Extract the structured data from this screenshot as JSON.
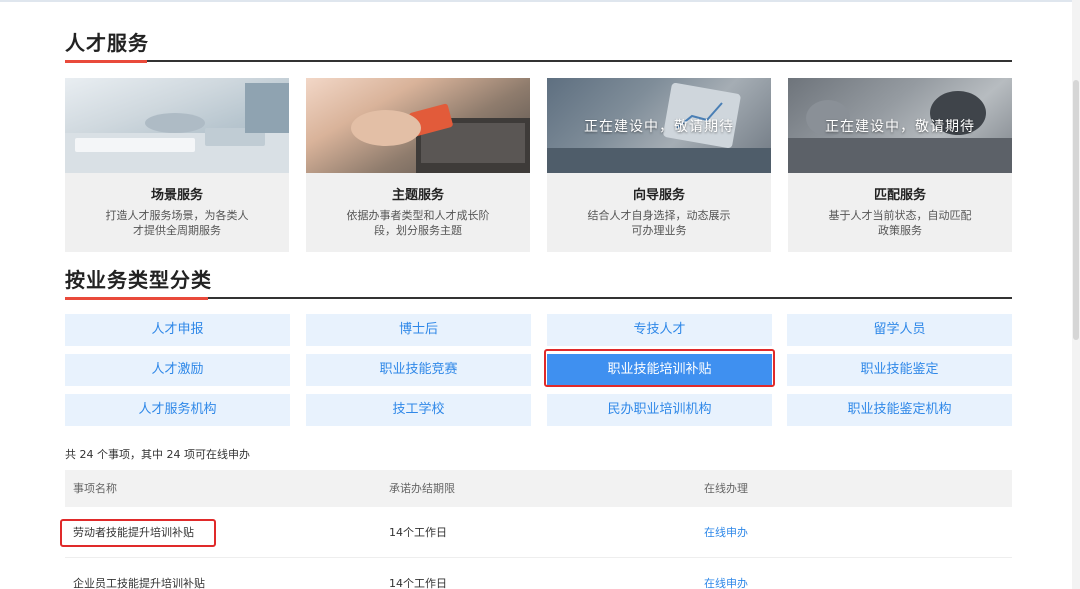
{
  "sections": {
    "talent_service_title": "人才服务",
    "by_type_title": "按业务类型分类"
  },
  "cards": [
    {
      "title": "场景服务",
      "desc_line1": "打造人才服务场景，为各类人",
      "desc_line2": "才提供全周期服务",
      "overlay": ""
    },
    {
      "title": "主题服务",
      "desc_line1": "依据办事者类型和人才成长阶",
      "desc_line2": "段，划分服务主题",
      "overlay": ""
    },
    {
      "title": "向导服务",
      "desc_line1": "结合人才自身选择，动态展示",
      "desc_line2": "可办理业务",
      "overlay": "正在建设中，敬请期待"
    },
    {
      "title": "匹配服务",
      "desc_line1": "基于人才当前状态，自动匹配",
      "desc_line2": "政策服务",
      "overlay": "正在建设中，敬请期待"
    }
  ],
  "categories": [
    [
      "人才申报",
      "博士后",
      "专技人才",
      "留学人员"
    ],
    [
      "人才激励",
      "职业技能竞赛",
      "职业技能培训补贴",
      "职业技能鉴定"
    ],
    [
      "人才服务机构",
      "技工学校",
      "民办职业培训机构",
      "职业技能鉴定机构"
    ]
  ],
  "active_category": "职业技能培训补贴",
  "summary": "共 24 个事项，其中 24 项可在线申办",
  "table": {
    "headers": [
      "事项名称",
      "承诺办结期限",
      "在线办理"
    ],
    "rows": [
      {
        "name": "劳动者技能提升培训补贴",
        "deadline": "14个工作日",
        "action": "在线申办"
      },
      {
        "name": "企业员工技能提升培训补贴",
        "deadline": "14个工作日",
        "action": "在线申办"
      }
    ]
  },
  "colors": {
    "accent_red": "#e94a3b",
    "button_bg": "#e8f2fd",
    "button_text": "#2f88e8",
    "active_bg": "#3f90f0",
    "highlight_border": "#e02a2a"
  }
}
